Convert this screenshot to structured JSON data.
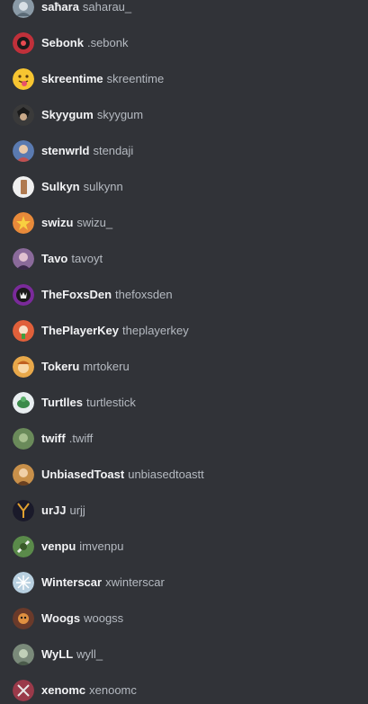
{
  "users": [
    {
      "display": "saħara",
      "handle": "saharau_",
      "avatar_icon": "avatar-icon",
      "avatar_color": "#8a9aa6"
    },
    {
      "display": "Sebonk",
      "handle": ".sebonk",
      "avatar_icon": "avatar-icon",
      "avatar_color": "#c0303a"
    },
    {
      "display": "skreentime",
      "handle": "skreentime",
      "avatar_icon": "emoji-tongue-icon",
      "avatar_color": "#f7c531"
    },
    {
      "display": "Skyygum",
      "handle": "skyygum",
      "avatar_icon": "avatar-icon",
      "avatar_color": "#3a3a3a"
    },
    {
      "display": "stenwrld",
      "handle": "stendaji",
      "avatar_icon": "avatar-icon",
      "avatar_color": "#5a7ab0"
    },
    {
      "display": "Sulkyn",
      "handle": "sulkynn",
      "avatar_icon": "avatar-icon",
      "avatar_color": "#f0f0f0"
    },
    {
      "display": "swizu",
      "handle": "swizu_",
      "avatar_icon": "avatar-icon",
      "avatar_color": "#e88a3a"
    },
    {
      "display": "Tavo",
      "handle": "tavoyt",
      "avatar_icon": "avatar-icon",
      "avatar_color": "#8a6a9a"
    },
    {
      "display": "TheFoxsDen",
      "handle": "thefoxsden",
      "avatar_icon": "avatar-icon",
      "avatar_color": "#7a2a9a"
    },
    {
      "display": "ThePlayerKey",
      "handle": "theplayerkey",
      "avatar_icon": "avatar-icon",
      "avatar_color": "#e0603a"
    },
    {
      "display": "Tokeru",
      "handle": "mrtokeru",
      "avatar_icon": "avatar-icon",
      "avatar_color": "#e8a84a"
    },
    {
      "display": "Turtlles",
      "handle": "turtlestick",
      "avatar_icon": "avatar-icon",
      "avatar_color": "#e8eef0"
    },
    {
      "display": "twiff",
      "handle": ".twiff",
      "avatar_icon": "avatar-icon",
      "avatar_color": "#6a8a5a"
    },
    {
      "display": "UnbiasedToast",
      "handle": "unbiasedtoastt",
      "avatar_icon": "avatar-icon",
      "avatar_color": "#c8904a"
    },
    {
      "display": "urJJ",
      "handle": "urjj",
      "avatar_icon": "avatar-icon",
      "avatar_color": "#1a1a2a"
    },
    {
      "display": "venpu",
      "handle": "imvenpu",
      "avatar_icon": "avatar-icon",
      "avatar_color": "#5a8a4a"
    },
    {
      "display": "Winterscar",
      "handle": "xwinterscar",
      "avatar_icon": "avatar-icon",
      "avatar_color": "#b8d0e0"
    },
    {
      "display": "Woogs",
      "handle": "woogss",
      "avatar_icon": "avatar-icon",
      "avatar_color": "#6a3a2a"
    },
    {
      "display": "WyLL",
      "handle": "wyll_",
      "avatar_icon": "avatar-icon",
      "avatar_color": "#7a8a7a"
    },
    {
      "display": "xenomc",
      "handle": "xenoomc",
      "avatar_icon": "avatar-icon",
      "avatar_color": "#9a3a4a"
    }
  ]
}
